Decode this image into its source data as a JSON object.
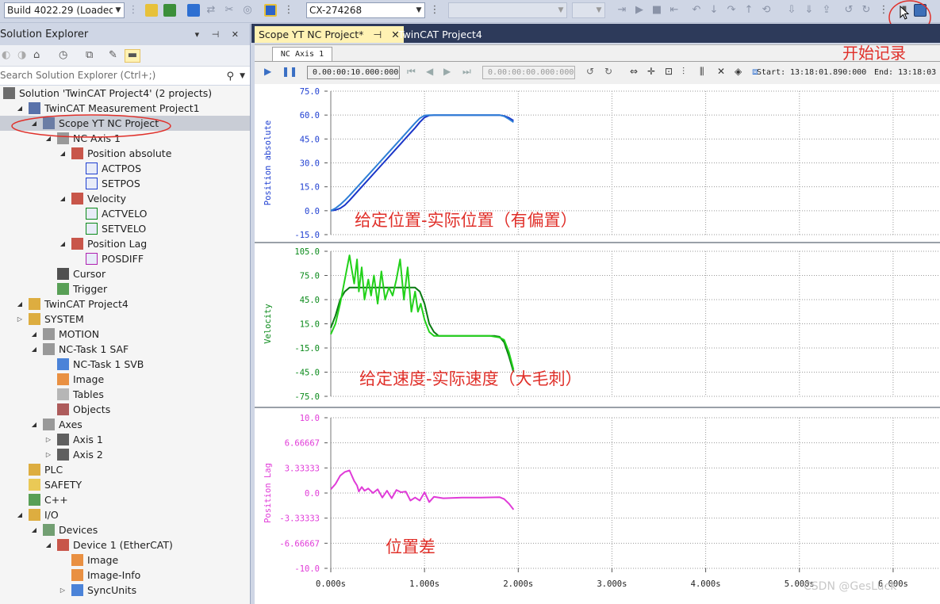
{
  "toolbar": {
    "build_combo": "Build 4022.29 (Loaded",
    "target_combo": "CX-274268"
  },
  "solution_explorer": {
    "title": "Solution Explorer",
    "search_placeholder": "Search Solution Explorer (Ctrl+;)",
    "tree": [
      {
        "label": "Solution 'TwinCAT Project4' (2 projects)",
        "icon": "solution-icon",
        "expander": ""
      },
      {
        "label": "TwinCAT Measurement Project1",
        "icon": "measurement-project-icon",
        "expander": "◢"
      },
      {
        "label": "Scope YT NC Project",
        "icon": "scope-icon",
        "expander": "◢"
      },
      {
        "label": "NC Axis 1",
        "icon": "chart-icon",
        "expander": "◢"
      },
      {
        "label": "Position absolute",
        "icon": "axis-icon",
        "expander": "◢"
      },
      {
        "label": "ACTPOS",
        "icon": "channel-icon",
        "expander": ""
      },
      {
        "label": "SETPOS",
        "icon": "channel-icon",
        "expander": ""
      },
      {
        "label": "Velocity",
        "icon": "axis-icon",
        "expander": "◢"
      },
      {
        "label": "ACTVELO",
        "icon": "channel-icon",
        "expander": ""
      },
      {
        "label": "SETVELO",
        "icon": "channel-icon",
        "expander": ""
      },
      {
        "label": "Position Lag",
        "icon": "axis-icon",
        "expander": "◢"
      },
      {
        "label": "POSDIFF",
        "icon": "channel-icon",
        "expander": ""
      },
      {
        "label": "Cursor",
        "icon": "cursor-icon",
        "expander": ""
      },
      {
        "label": "Trigger",
        "icon": "trigger-icon",
        "expander": ""
      },
      {
        "label": "TwinCAT Project4",
        "icon": "project-icon",
        "expander": "◢"
      },
      {
        "label": "SYSTEM",
        "icon": "system-icon",
        "expander": "▷"
      },
      {
        "label": "MOTION",
        "icon": "motion-icon",
        "expander": "◢"
      },
      {
        "label": "NC-Task 1 SAF",
        "icon": "task-icon",
        "expander": "◢"
      },
      {
        "label": "NC-Task 1 SVB",
        "icon": "task-svb-icon",
        "expander": ""
      },
      {
        "label": "Image",
        "icon": "image-icon",
        "expander": ""
      },
      {
        "label": "Tables",
        "icon": "tables-icon",
        "expander": ""
      },
      {
        "label": "Objects",
        "icon": "objects-icon",
        "expander": ""
      },
      {
        "label": "Axes",
        "icon": "axes-icon",
        "expander": "◢"
      },
      {
        "label": "Axis 1",
        "icon": "axis-item-icon",
        "expander": "▷"
      },
      {
        "label": "Axis 2",
        "icon": "axis-item-icon",
        "expander": "▷"
      },
      {
        "label": "PLC",
        "icon": "plc-icon",
        "expander": ""
      },
      {
        "label": "SAFETY",
        "icon": "safety-icon",
        "expander": ""
      },
      {
        "label": "C++",
        "icon": "cpp-icon",
        "expander": ""
      },
      {
        "label": "I/O",
        "icon": "io-icon",
        "expander": "◢"
      },
      {
        "label": "Devices",
        "icon": "devices-icon",
        "expander": "◢"
      },
      {
        "label": "Device 1 (EtherCAT)",
        "icon": "ethercat-icon",
        "expander": "◢"
      },
      {
        "label": "Image",
        "icon": "image-icon",
        "expander": ""
      },
      {
        "label": "Image-Info",
        "icon": "image-icon",
        "expander": ""
      },
      {
        "label": "SyncUnits",
        "icon": "sync-icon",
        "expander": "▷"
      }
    ]
  },
  "tabs": [
    {
      "label": "Scope YT NC Project*",
      "pin": "⊣",
      "close": "✕"
    },
    {
      "label": "TwinCAT Project4"
    }
  ],
  "scope": {
    "subtab": "NC Axis 1",
    "time_span": "0.00:00:10.000:000",
    "time_offset": "0.00:00:00.000:000",
    "start_label": "Start:",
    "start_value": "13:18:01.890:000",
    "end_label": "End:",
    "end_value": "13:18:03"
  },
  "annotations": {
    "record": "开始记录",
    "position": "给定位置-实际位置（有偏置）",
    "velocity": "给定速度-实际速度（大毛刺）",
    "lag": "位置差"
  },
  "watermark": "CSDN @GesLuck",
  "chart_data": [
    {
      "type": "line",
      "ylabel": "Position absolute",
      "ylim": [
        -15,
        75
      ],
      "yticks": [
        "75.0",
        "60.0",
        "45.0",
        "30.0",
        "15.0",
        "0.0",
        "-15.0"
      ],
      "color": "#1f3fd1",
      "series": [
        {
          "x": [
            0,
            0.05,
            0.1,
            0.15,
            0.2,
            0.3,
            0.4,
            0.5,
            0.6,
            0.7,
            0.8,
            0.9,
            0.95,
            1.0,
            1.05,
            1.1,
            1.2,
            1.4,
            1.6,
            1.8,
            1.85,
            1.9,
            1.95
          ],
          "y": [
            0,
            0.4,
            1.5,
            3.5,
            6.5,
            13,
            19.5,
            26,
            32.5,
            39,
            45.5,
            52,
            55.5,
            58.5,
            59.8,
            60,
            60,
            60,
            60,
            60,
            59.5,
            58.3,
            56.5
          ]
        },
        {
          "x": [
            0,
            0.05,
            0.1,
            0.15,
            0.2,
            0.3,
            0.4,
            0.5,
            0.6,
            0.7,
            0.8,
            0.9,
            0.95,
            1.0,
            1.05,
            1.1,
            1.2,
            1.4,
            1.6,
            1.8,
            1.85,
            1.9,
            1.95
          ],
          "y": [
            0,
            1.5,
            3.8,
            6.5,
            9.5,
            16,
            22.5,
            29,
            35.5,
            42,
            48.5,
            55,
            58,
            59.8,
            60,
            60,
            60,
            60,
            60,
            60,
            59.3,
            57.5,
            55.5
          ]
        }
      ]
    },
    {
      "type": "line",
      "ylabel": "Velocity",
      "ylim": [
        -75,
        105
      ],
      "yticks": [
        "105.0",
        "75.0",
        "45.0",
        "15.0",
        "-15.0",
        "-45.0",
        "-75.0"
      ],
      "color": "#0a8a1a",
      "series": [
        {
          "x": [
            0,
            0.05,
            0.1,
            0.15,
            0.2,
            0.3,
            0.4,
            0.5,
            0.6,
            0.7,
            0.8,
            0.9,
            0.95,
            1.0,
            1.05,
            1.1,
            1.15,
            1.2,
            1.4,
            1.6,
            1.7,
            1.75,
            1.8,
            1.85,
            1.9,
            1.95
          ],
          "y": [
            10,
            25,
            45,
            55,
            60,
            60,
            60,
            60,
            60,
            60,
            60,
            60,
            55,
            40,
            15,
            5,
            0,
            0,
            0,
            0,
            0,
            0,
            -1,
            -8,
            -25,
            -45
          ]
        },
        {
          "x": [
            0,
            0.05,
            0.1,
            0.15,
            0.2,
            0.22,
            0.25,
            0.28,
            0.3,
            0.33,
            0.36,
            0.4,
            0.43,
            0.46,
            0.5,
            0.54,
            0.58,
            0.62,
            0.66,
            0.7,
            0.74,
            0.78,
            0.82,
            0.86,
            0.9,
            0.93,
            0.96,
            1.0,
            1.05,
            1.1,
            1.15,
            1.3,
            1.5,
            1.7,
            1.75,
            1.8,
            1.85,
            1.9,
            1.95
          ],
          "y": [
            2,
            15,
            40,
            70,
            100,
            85,
            65,
            95,
            55,
            85,
            45,
            70,
            50,
            75,
            40,
            80,
            45,
            60,
            50,
            70,
            95,
            45,
            85,
            30,
            55,
            30,
            40,
            20,
            5,
            0,
            0,
            0,
            0,
            0,
            -1,
            -2,
            -5,
            -20,
            -42
          ]
        }
      ]
    },
    {
      "type": "line",
      "ylabel": "Position Lag",
      "ylim": [
        -10,
        10
      ],
      "yticks": [
        "10.0",
        "6.66667",
        "3.33333",
        "0.0",
        "-3.33333",
        "-6.66667",
        "-10.0"
      ],
      "color": "#e03bd8",
      "series": [
        {
          "x": [
            0,
            0.05,
            0.1,
            0.15,
            0.2,
            0.25,
            0.28,
            0.3,
            0.33,
            0.36,
            0.4,
            0.45,
            0.5,
            0.55,
            0.6,
            0.65,
            0.7,
            0.75,
            0.8,
            0.85,
            0.9,
            0.95,
            1.0,
            1.05,
            1.1,
            1.2,
            1.4,
            1.6,
            1.8,
            1.85,
            1.9,
            1.95
          ],
          "y": [
            0.5,
            1.2,
            2.3,
            2.8,
            3.0,
            1.6,
            1.0,
            0.2,
            0.8,
            0.3,
            0.6,
            0.0,
            0.5,
            -0.6,
            0.3,
            -0.7,
            0.4,
            0.1,
            0.2,
            -1.0,
            -0.6,
            -1.0,
            0.1,
            -1.2,
            -0.5,
            -0.7,
            -0.6,
            -0.6,
            -0.55,
            -0.8,
            -1.4,
            -2.2
          ]
        }
      ]
    }
  ],
  "x_axis": {
    "ticks": [
      "0.000s",
      "1.000s",
      "2.000s",
      "3.000s",
      "4.000s",
      "5.000s",
      "6.000s"
    ],
    "range": [
      0,
      6.5
    ]
  }
}
